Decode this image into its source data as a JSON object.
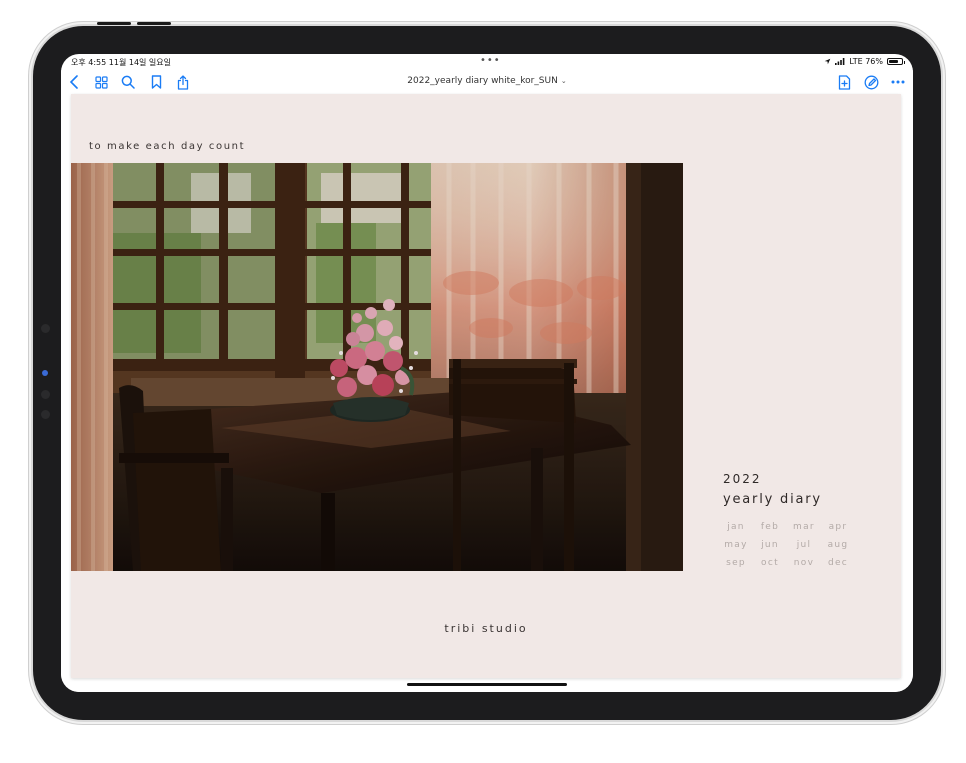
{
  "status_bar": {
    "time_date": "오후 4:55  11월 14일 일요일",
    "dots": "•••",
    "network": "LTE 76%"
  },
  "toolbar": {
    "back_icon": "chevron-left-icon",
    "grid_icon": "grid-icon",
    "search_icon": "search-icon",
    "bookmark_icon": "bookmark-icon",
    "share_icon": "share-icon",
    "doc_title": "2022_yearly diary white_kor_SUN",
    "title_chevron": "⌄",
    "add_page_icon": "add-page-icon",
    "pencil_icon": "pencil-icon",
    "more_icon": "more-icon",
    "accent_color": "#1a7cf5"
  },
  "page": {
    "tagline": "to make each day count",
    "year": "2022",
    "title": "yearly diary",
    "months": [
      "jan",
      "feb",
      "mar",
      "apr",
      "may",
      "jun",
      "jul",
      "aug",
      "sep",
      "oct",
      "nov",
      "dec"
    ],
    "studio": "tribi studio",
    "background_color": "#f1e8e6"
  },
  "battery_level": 0.76
}
